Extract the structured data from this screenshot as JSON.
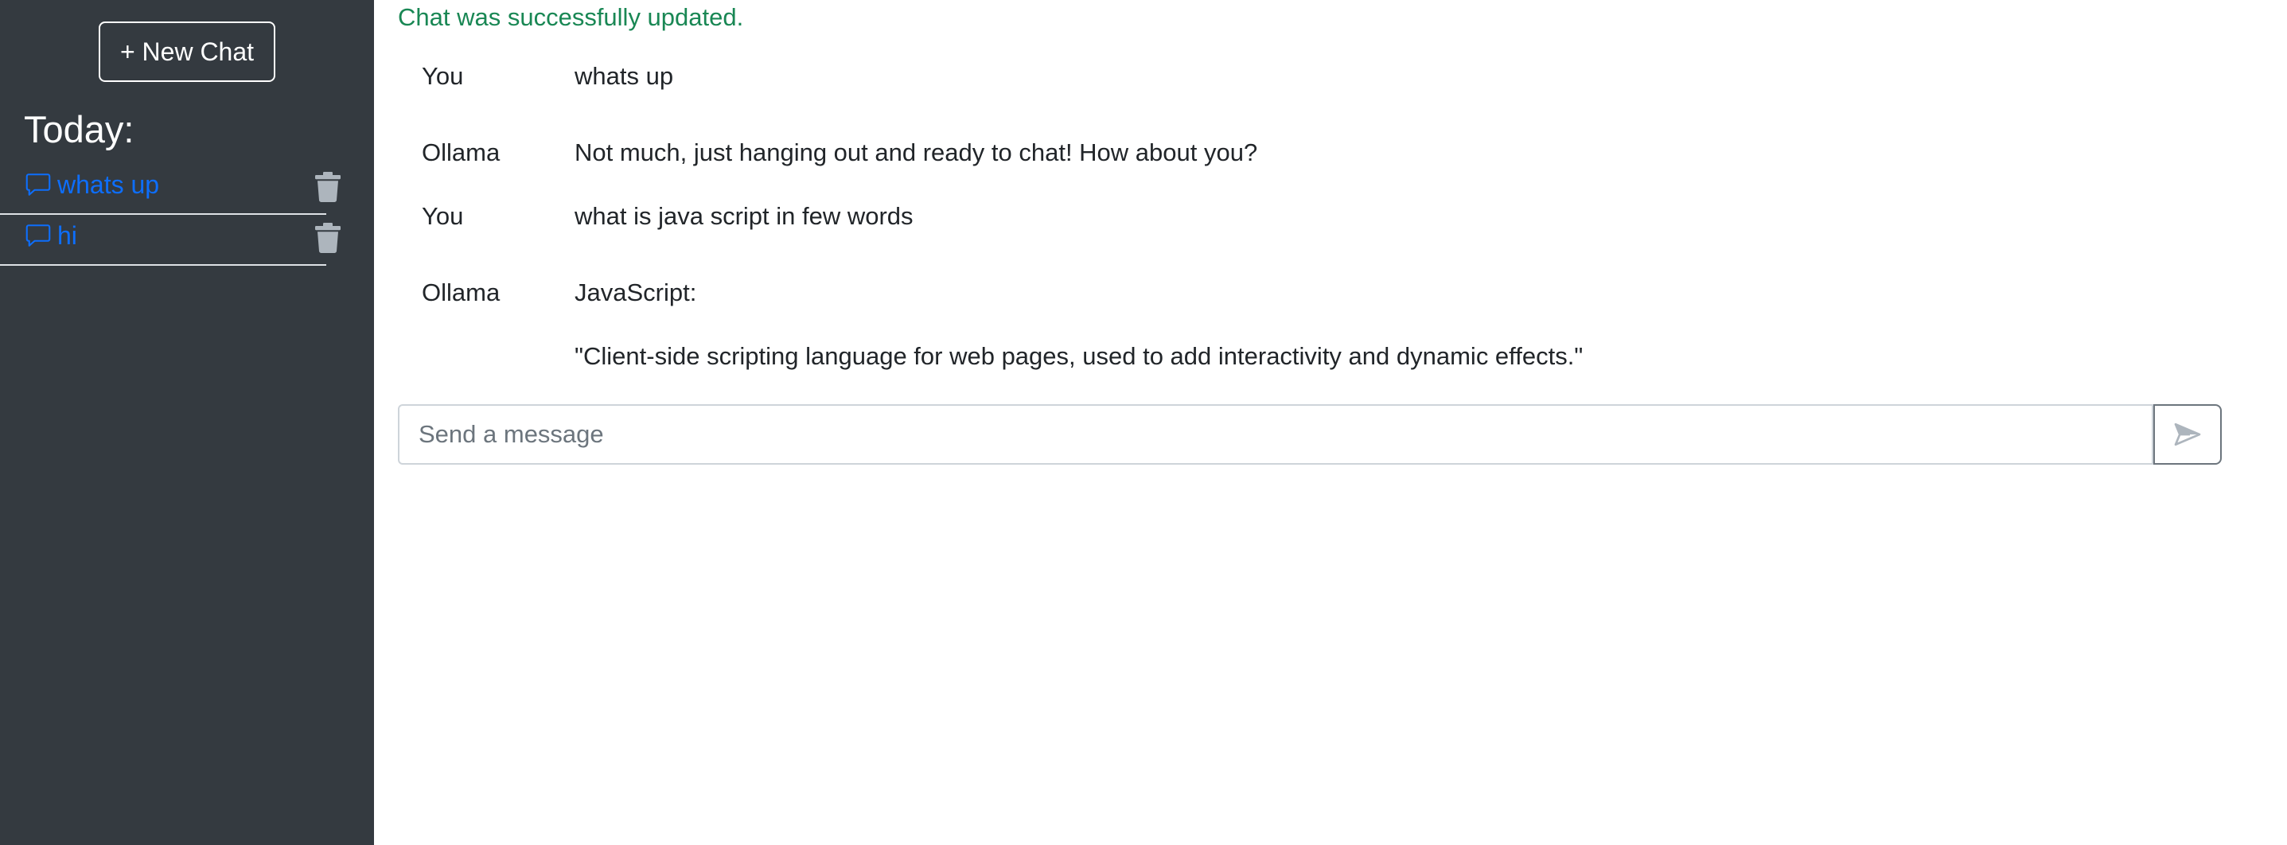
{
  "sidebar": {
    "new_chat_label": "+ New Chat",
    "section_heading": "Today:",
    "chats": [
      {
        "title": "whats up",
        "icon": "chat-bubble-icon",
        "delete_icon": "trash-icon"
      },
      {
        "title": "hi",
        "icon": "chat-bubble-icon",
        "delete_icon": "trash-icon"
      }
    ]
  },
  "main": {
    "status_message": "Chat was successfully updated.",
    "messages": [
      {
        "sender": "You",
        "lines": [
          "whats up"
        ]
      },
      {
        "sender": "Ollama",
        "lines": [
          "Not much, just hanging out and ready to chat! How about you?"
        ]
      },
      {
        "sender": "You",
        "lines": [
          "what is java script in few words"
        ]
      },
      {
        "sender": "Ollama",
        "lines": [
          "JavaScript:",
          "\"Client-side scripting language for web pages, used to add interactivity and dynamic effects.\""
        ]
      }
    ],
    "composer": {
      "placeholder": "Send a message",
      "value": "",
      "send_icon": "send-icon"
    }
  },
  "colors": {
    "sidebar_bg": "#343a40",
    "link": "#0d6efd",
    "success": "#198754",
    "trash": "#adb5bd"
  }
}
